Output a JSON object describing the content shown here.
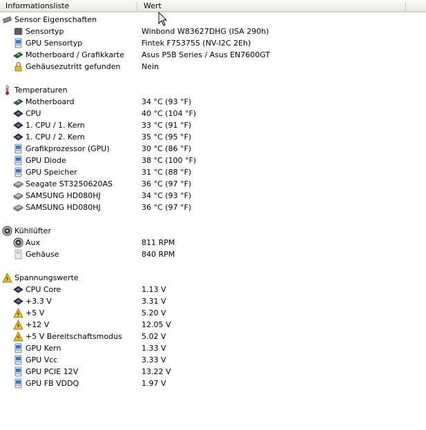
{
  "header": {
    "col_name": "Informationsliste",
    "col_value": "Wert"
  },
  "groups": [
    {
      "label": "Sensor Eigenschaften",
      "icon": "sensor-chip-icon",
      "items": [
        {
          "label": "Sensortyp",
          "value": "Winbond W83627DHG  (ISA 290h)",
          "icon": "chip-icon"
        },
        {
          "label": "GPU Sensortyp",
          "value": "Fintek F75375S  (NV-I2C 2Eh)",
          "icon": "gpu-icon"
        },
        {
          "label": "Motherboard / Grafikkarte",
          "value": "Asus P5B Series / Asus EN7600GT",
          "icon": "motherboard-icon"
        },
        {
          "label": "Gehäusezutritt gefunden",
          "value": "Nein",
          "icon": "lock-icon"
        }
      ]
    },
    {
      "label": "Temperaturen",
      "icon": "thermometer-icon",
      "items": [
        {
          "label": "Motherboard",
          "value": "34 °C  (93 °F)",
          "icon": "motherboard-icon"
        },
        {
          "label": "CPU",
          "value": "40 °C  (104 °F)",
          "icon": "cpu-icon"
        },
        {
          "label": "1. CPU / 1. Kern",
          "value": "33 °C  (91 °F)",
          "icon": "cpu-icon"
        },
        {
          "label": "1. CPU / 2. Kern",
          "value": "35 °C  (95 °F)",
          "icon": "cpu-icon"
        },
        {
          "label": "Grafikprozessor (GPU)",
          "value": "30 °C  (86 °F)",
          "icon": "gpu-icon"
        },
        {
          "label": "GPU Diode",
          "value": "38 °C  (100 °F)",
          "icon": "gpu-icon"
        },
        {
          "label": "GPU Speicher",
          "value": "31 °C  (88 °F)",
          "icon": "gpu-icon"
        },
        {
          "label": "Seagate ST3250620AS",
          "value": "36 °C  (97 °F)",
          "icon": "hard-drive-icon"
        },
        {
          "label": "SAMSUNG HD080HJ",
          "value": "34 °C  (93 °F)",
          "icon": "hard-drive-icon"
        },
        {
          "label": "SAMSUNG HD080HJ",
          "value": "36 °C  (97 °F)",
          "icon": "hard-drive-icon"
        }
      ]
    },
    {
      "label": "Kühllüfter",
      "icon": "fan-icon",
      "items": [
        {
          "label": "Aux",
          "value": "811 RPM",
          "icon": "fan-icon"
        },
        {
          "label": "Gehäuse",
          "value": "840 RPM",
          "icon": "case-icon"
        }
      ]
    },
    {
      "label": "Spannungswerte",
      "icon": "voltage-icon",
      "items": [
        {
          "label": "CPU Core",
          "value": "1.13 V",
          "icon": "cpu-icon"
        },
        {
          "label": "+3.3 V",
          "value": "3.31 V",
          "icon": "cpu-icon"
        },
        {
          "label": "+5 V",
          "value": "5.20 V",
          "icon": "voltage-icon"
        },
        {
          "label": "+12 V",
          "value": "12.05 V",
          "icon": "voltage-icon"
        },
        {
          "label": "+5 V Bereitschaftsmodus",
          "value": "5.02 V",
          "icon": "voltage-icon"
        },
        {
          "label": "GPU Kern",
          "value": "1.33 V",
          "icon": "gpu-icon"
        },
        {
          "label": "GPU Vcc",
          "value": "3.33 V",
          "icon": "gpu-icon"
        },
        {
          "label": "GPU PCIE 12V",
          "value": "13.22 V",
          "icon": "gpu-icon"
        },
        {
          "label": "GPU FB VDDQ",
          "value": "1.97 V",
          "icon": "gpu-icon"
        }
      ]
    }
  ],
  "colors": {
    "header_border": "#d6d3c2",
    "gpu_blue": "#3a78c8",
    "voltage_yellow": "#e8c020",
    "chip_dark": "#3a3f5a"
  }
}
